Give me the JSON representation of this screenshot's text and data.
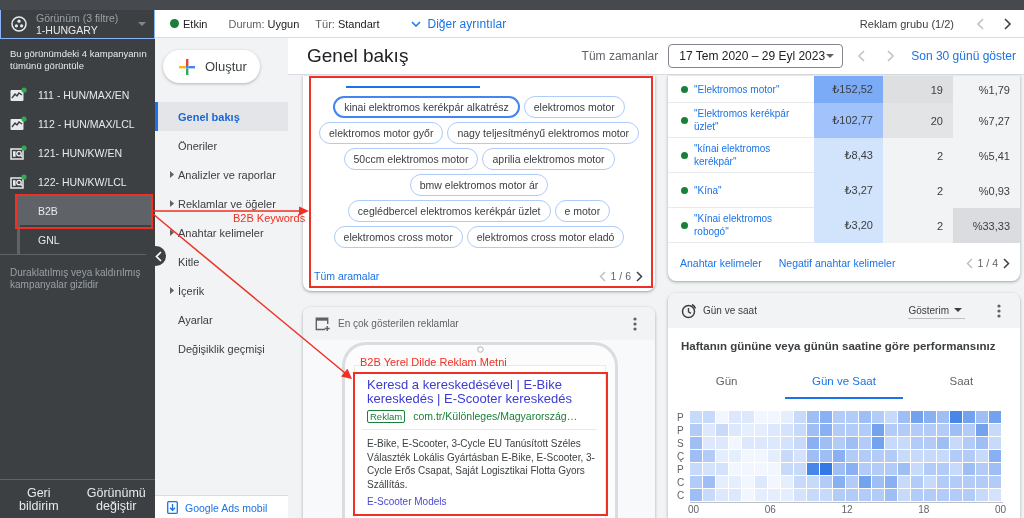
{
  "sidebar": {
    "view": {
      "label": "Görünüm (3 filtre)",
      "value": "1-HUNGARY"
    },
    "view_all": "Bu görünümdeki 4 kampanyanın tümünü görüntüle",
    "campaigns": [
      {
        "name": "111 - HUN/MAX/EN",
        "kind": "pmax",
        "active": true,
        "selected": false
      },
      {
        "name": "112 - HUN/MAX/LCL",
        "kind": "pmax",
        "active": true,
        "selected": false
      },
      {
        "name": "121- HUN/KW/EN",
        "kind": "search",
        "active": true,
        "selected": false
      },
      {
        "name": "122- HUN/KW/LCL",
        "kind": "search",
        "active": true,
        "selected": false,
        "children": [
          {
            "name": "B2B",
            "selected": true
          },
          {
            "name": "GNL",
            "selected": false
          }
        ]
      }
    ],
    "hidden_note": "Duraklatılmış veya kaldırılmış kampanyalar gizlidir",
    "footer_buttons": [
      "Geri bildirim",
      "Görünümü değiştir"
    ]
  },
  "status_bar": {
    "status": {
      "label": "Etkin",
      "active": true
    },
    "fields": [
      {
        "label": "Durum:",
        "value": "Uygun"
      },
      {
        "label": "Tür:",
        "value": "Standart"
      }
    ],
    "details_link": "Diğer ayrıntılar",
    "ad_group": "Reklam grubu (1/2)",
    "prev_disabled": true,
    "next_disabled": false
  },
  "nav": {
    "create_button": "Oluştur",
    "items": [
      {
        "label": "Genel bakış",
        "kind": "page",
        "selected": true
      },
      {
        "label": "Öneriler",
        "kind": "page",
        "selected": false
      },
      {
        "label": "Analizler ve raporlar",
        "kind": "group",
        "selected": false
      },
      {
        "label": "Reklamlar ve öğeler",
        "kind": "group",
        "selected": false
      },
      {
        "label": "Anahtar kelimeler",
        "kind": "group",
        "selected": false
      },
      {
        "label": "Kitle",
        "kind": "page",
        "selected": false
      },
      {
        "label": "İçerik",
        "kind": "group",
        "selected": false
      },
      {
        "label": "Ayarlar",
        "kind": "page",
        "selected": false
      },
      {
        "label": "Değişiklik geçmişi",
        "kind": "page",
        "selected": false
      }
    ],
    "mobile_link": "Google Ads mobil"
  },
  "header": {
    "title": "Genel bakış",
    "range_label": "Tüm zamanlar",
    "date_range": "17 Tem 2020 – 29 Eyl 2023",
    "prev_disabled": true,
    "next_disabled": true,
    "recent_link": "Son 30 günü göster"
  },
  "search_terms": {
    "chips": [
      {
        "text": "kinai elektromos kerékpár alkatrész",
        "selected": true
      },
      {
        "text": "elektromos motor",
        "selected": false
      },
      {
        "text": "elektromos motor győr",
        "selected": false
      },
      {
        "text": "nagy teljesítményű elektromos motor",
        "selected": false
      },
      {
        "text": "50ccm elektromos motor",
        "selected": false
      },
      {
        "text": "aprilia elektromos motor",
        "selected": false
      },
      {
        "text": "bmw elektromos motor ár",
        "selected": false
      },
      {
        "text": "ceglédbercel elektromos kerékpár üzlet",
        "selected": false
      },
      {
        "text": "e motor",
        "selected": false
      },
      {
        "text": "elektromos cross motor",
        "selected": false
      },
      {
        "text": "elektromos cross motor eladó",
        "selected": false
      }
    ],
    "link": "Tüm aramalar",
    "pager": {
      "text": "1 / 6",
      "prev_disabled": true,
      "next_disabled": false
    }
  },
  "keywords": {
    "rows": [
      {
        "column_1": "\"Elektromos motor\"",
        "enabled": true,
        "column_2": {
          "text": "₺152,52",
          "color": "#7baaf7"
        },
        "column_3": {
          "text": "19",
          "color": "#dedfe1"
        },
        "column_4": {
          "text": "%1,79",
          "color": "#f1f3f4"
        }
      },
      {
        "column_1": "\"Elektromos kerékpár üzlet\"",
        "enabled": true,
        "column_2": {
          "text": "₺102,77",
          "color": "#a1c2fa"
        },
        "column_3": {
          "text": "20",
          "color": "#e3e4e6"
        },
        "column_4": {
          "text": "%7,27",
          "color": "#f1f3f4"
        }
      },
      {
        "column_1": "\"kínai elektromos kerékpár\"",
        "enabled": true,
        "column_2": {
          "text": "₺8,43",
          "color": "#d2e3fc"
        },
        "column_3": {
          "text": "2",
          "color": "#f1f3f4"
        },
        "column_4": {
          "text": "%5,41",
          "color": "#f1f3f4"
        }
      },
      {
        "column_1": "\"Kína\"",
        "enabled": true,
        "column_2": {
          "text": "₺3,27",
          "color": "#d2e3fc"
        },
        "column_3": {
          "text": "2",
          "color": "#f1f3f4"
        },
        "column_4": {
          "text": "%0,93",
          "color": "#f1f3f4"
        }
      },
      {
        "column_1": "\"Kínai elektromos robogó\"",
        "enabled": true,
        "column_2": {
          "text": "₺3,20",
          "color": "#d2e3fc"
        },
        "column_3": {
          "text": "2",
          "color": "#f1f3f4"
        },
        "column_4": {
          "text": "%33,33",
          "color": "#dadce0"
        }
      }
    ],
    "links": [
      "Anahtar kelimeler",
      "Negatif anahtar kelimeler"
    ],
    "pager": {
      "text": "1 / 4",
      "prev_disabled": true,
      "next_disabled": false
    }
  },
  "top_ads": {
    "title": "En çok gösterilen reklamlar",
    "ad": {
      "headline": "Keresd a kereskedésével | E-Bike kereskedés | E-Scooter kereskedés",
      "badge": "Reklam",
      "url": "com.tr/Különleges/Magyarország…",
      "description": "E-Bike, E-Scooter, 3-Cycle EU Tanúsított Széles Választék Lokális Gyártásban E-Bike, E-Scooter, 3-Cycle Erős Csapat, Saját Logisztikai Flotta Gyors Szállítás.",
      "sitelink": "E-Scooter Models"
    }
  },
  "day_time": {
    "title": "Gün ve saat",
    "metric": "Gösterim",
    "subtitle": "Haftanın gününe veya günün saatine göre performansınız",
    "tabs": [
      {
        "label": "Gün",
        "selected": false
      },
      {
        "label": "Gün ve Saat",
        "selected": true
      },
      {
        "label": "Saat",
        "selected": false
      }
    ],
    "days": [
      "P",
      "P",
      "S",
      "Ç",
      "P",
      "C",
      "C"
    ],
    "hours": [
      "00",
      "06",
      "12",
      "18",
      "00"
    ]
  },
  "annotations": [
    {
      "text": "B2B Keywords"
    },
    {
      "text": "B2B Yerel Dilde Reklam Metni"
    }
  ]
}
